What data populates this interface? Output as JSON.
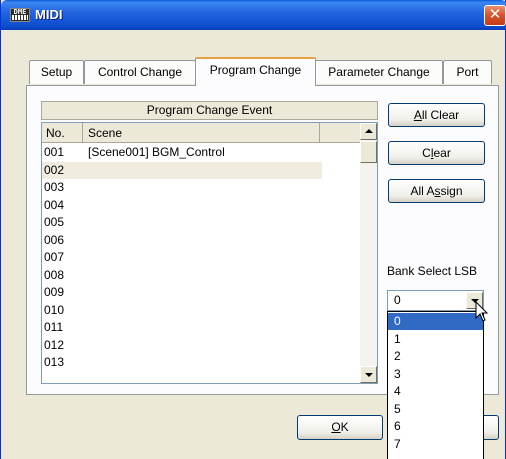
{
  "window": {
    "title": "MIDI",
    "app_icon_text": "DME",
    "close_glyph": "✕"
  },
  "tabs": [
    {
      "label": "Setup"
    },
    {
      "label": "Control Change"
    },
    {
      "label": "Program Change"
    },
    {
      "label": "Parameter Change"
    },
    {
      "label": "Port"
    }
  ],
  "active_tab": "Program Change",
  "section": {
    "header": "Program Change Event"
  },
  "table": {
    "columns": [
      "No.",
      "Scene"
    ],
    "rows": [
      {
        "no": "001",
        "scene": "[Scene001] BGM_Control"
      },
      {
        "no": "002",
        "scene": ""
      },
      {
        "no": "003",
        "scene": ""
      },
      {
        "no": "004",
        "scene": ""
      },
      {
        "no": "005",
        "scene": ""
      },
      {
        "no": "006",
        "scene": ""
      },
      {
        "no": "007",
        "scene": ""
      },
      {
        "no": "008",
        "scene": ""
      },
      {
        "no": "009",
        "scene": ""
      },
      {
        "no": "010",
        "scene": ""
      },
      {
        "no": "011",
        "scene": ""
      },
      {
        "no": "012",
        "scene": ""
      },
      {
        "no": "013",
        "scene": ""
      }
    ],
    "selected_row": "002"
  },
  "buttons": {
    "all_clear": {
      "pre": "",
      "key": "A",
      "post": "ll Clear"
    },
    "clear": {
      "pre": "C",
      "key": "l",
      "post": "ear"
    },
    "all_assign": {
      "pre": "All A",
      "key": "s",
      "post": "sign"
    },
    "ok": {
      "pre": "",
      "key": "O",
      "post": "K"
    }
  },
  "bank_select": {
    "label": "Bank Select LSB",
    "value": "0",
    "options": [
      "0",
      "1",
      "2",
      "3",
      "4",
      "5",
      "6",
      "7"
    ],
    "highlighted": "0"
  },
  "colors": {
    "titlebar": "#0a5bd8",
    "selection": "#316ac5",
    "tab_accent": "#e8a040",
    "close_button": "#d9502a"
  }
}
